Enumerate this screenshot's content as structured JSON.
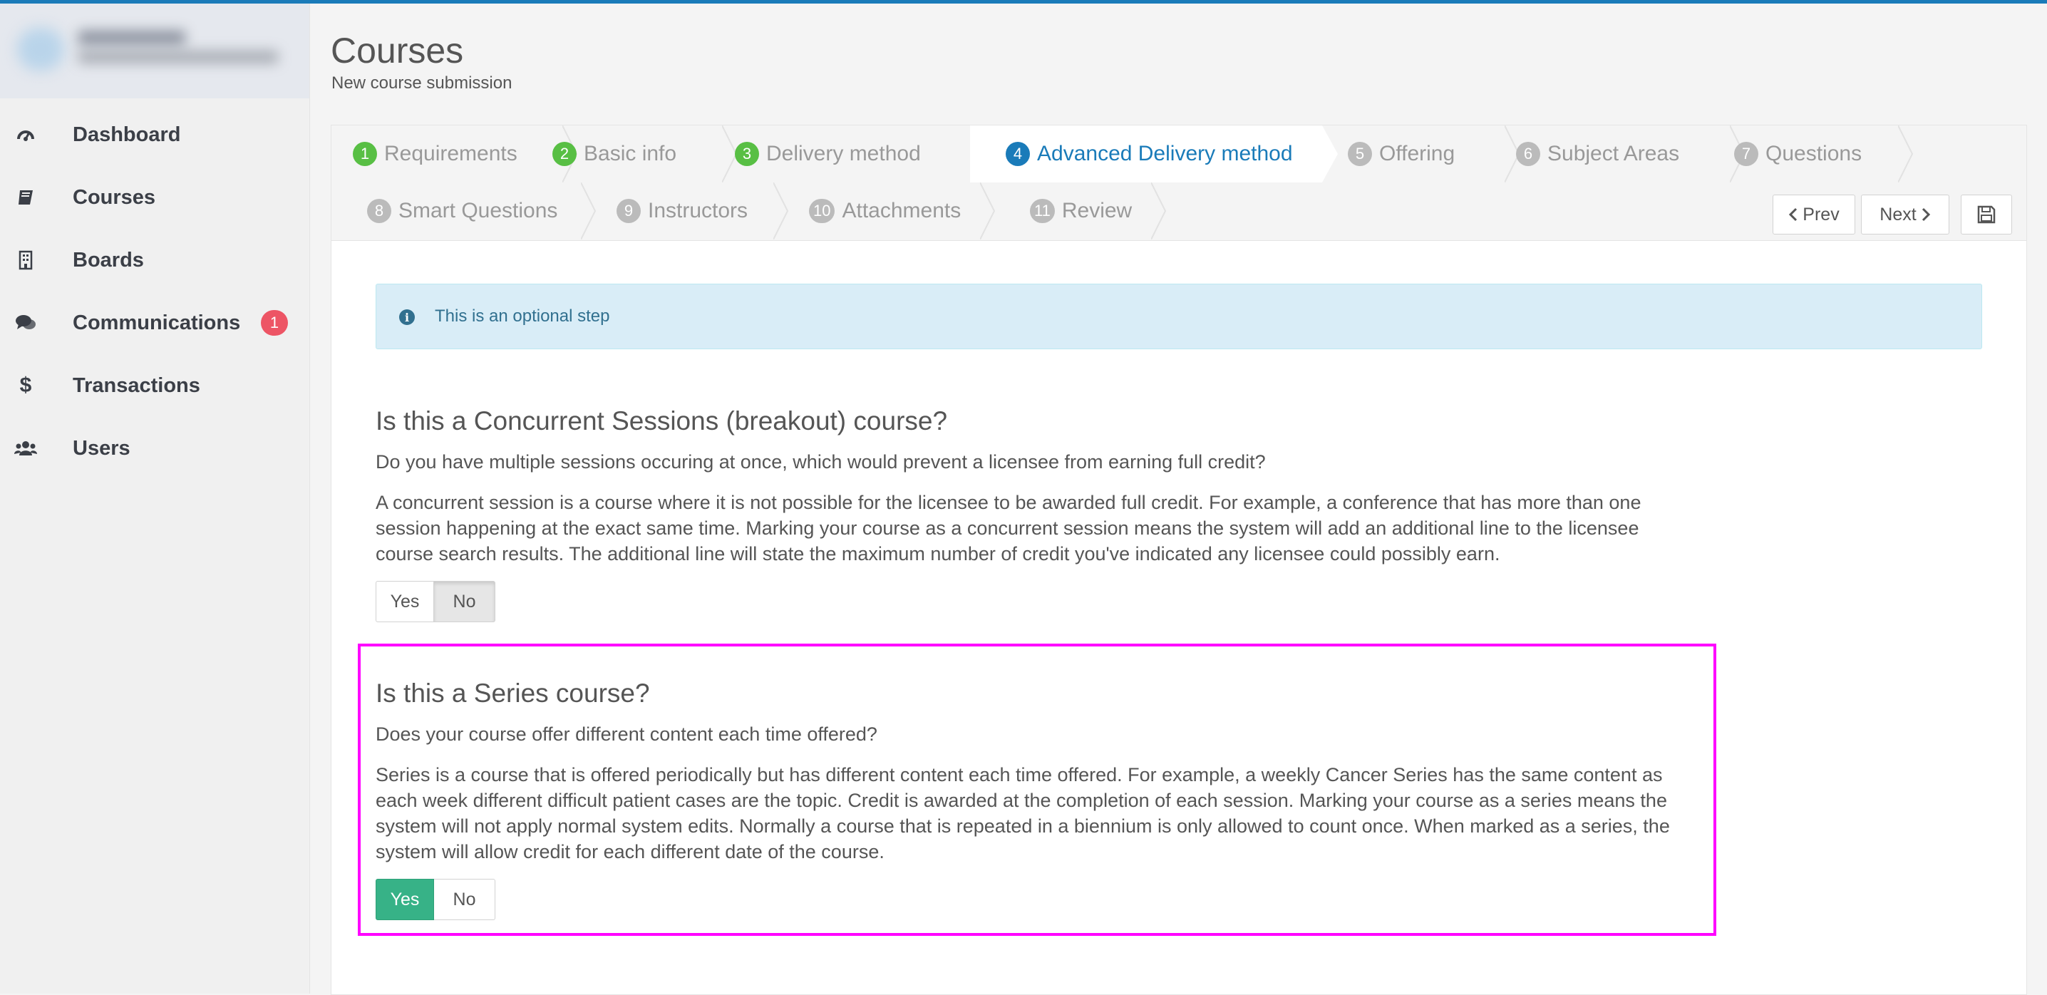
{
  "sidebar": {
    "items": [
      {
        "label": "Dashboard"
      },
      {
        "label": "Courses"
      },
      {
        "label": "Boards"
      },
      {
        "label": "Communications",
        "badge": "1"
      },
      {
        "label": "Transactions"
      },
      {
        "label": "Users"
      }
    ]
  },
  "header": {
    "title": "Courses",
    "subtitle": "New course submission"
  },
  "wizard": {
    "steps": [
      {
        "num": "1",
        "label": "Requirements"
      },
      {
        "num": "2",
        "label": "Basic info"
      },
      {
        "num": "3",
        "label": "Delivery method"
      },
      {
        "num": "4",
        "label": "Advanced Delivery method"
      },
      {
        "num": "5",
        "label": "Offering"
      },
      {
        "num": "6",
        "label": "Subject Areas"
      },
      {
        "num": "7",
        "label": "Questions"
      },
      {
        "num": "8",
        "label": "Smart Questions"
      },
      {
        "num": "9",
        "label": "Instructors"
      },
      {
        "num": "10",
        "label": "Attachments"
      },
      {
        "num": "11",
        "label": "Review"
      }
    ],
    "prev_label": "Prev",
    "next_label": "Next"
  },
  "alert": {
    "text": "This is an optional step"
  },
  "questions": [
    {
      "title": "Is this a Concurrent Sessions (breakout) course?",
      "subtitle": "Do you have multiple sessions occuring at once, which would prevent a licensee from earning full credit?",
      "lines": [
        "A concurrent session is a course where it is not possible for the licensee to be awarded full credit. For example, a conference that has more than one",
        "session happening at the exact same time. Marking your course as a concurrent session means the system will add an additional line to the licensee",
        "course search results. The additional line will state the maximum number of credit you've indicated any licensee could possibly earn."
      ],
      "yes_label": "Yes",
      "no_label": "No",
      "selected": "No"
    },
    {
      "title": "Is this a Series course?",
      "subtitle": "Does your course offer different content each time offered?",
      "lines": [
        "Series is a course that is offered periodically but has different content each time offered. For example, a weekly Cancer Series has the same content as",
        "each week different difficult patient cases are the topic. Credit is awarded at the completion of each session. Marking your course as a series means the",
        "system will not apply normal system edits. Normally a course that is repeated in a biennium is only allowed to count once. When marked as a series, the",
        "system will allow credit for each different date of the course."
      ],
      "yes_label": "Yes",
      "no_label": "No",
      "selected": "Yes"
    }
  ],
  "colors": {
    "accent": "#1a7bb9",
    "done": "#58bf44",
    "selected_yes": "#37b287",
    "badge": "#ed5565",
    "highlight": "#ff00ff"
  }
}
